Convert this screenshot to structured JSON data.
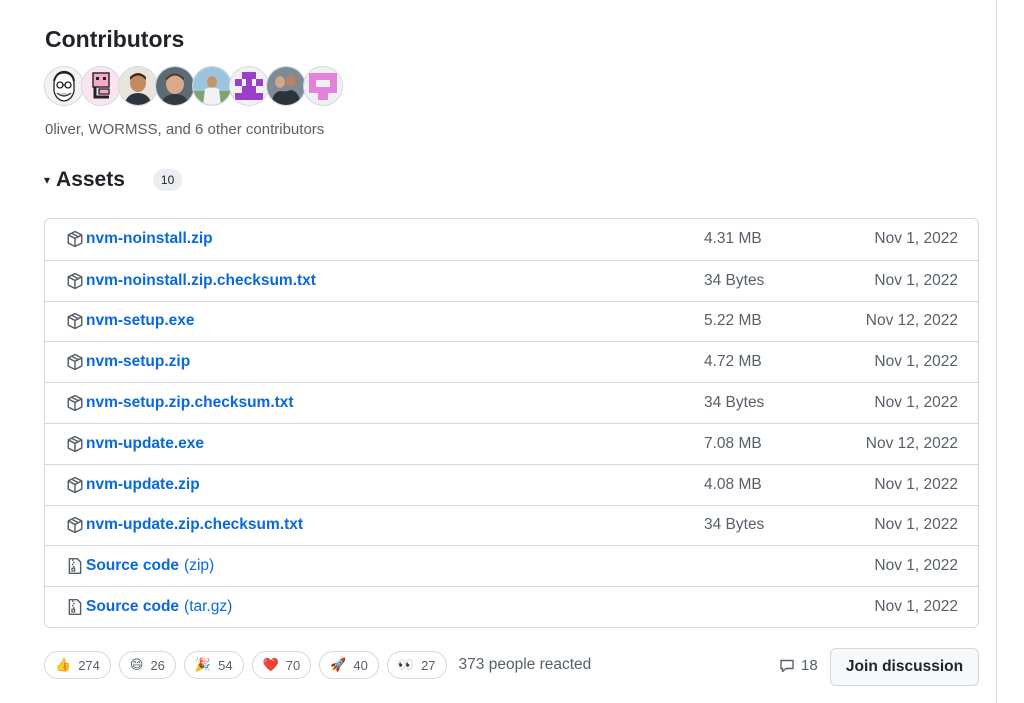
{
  "contributors": {
    "title": "Contributors",
    "summary": "0liver, WORMSS, and 6 other contributors",
    "avatars": [
      "avatar-sketch",
      "avatar-pink-pixel",
      "avatar-photo",
      "avatar-photo",
      "avatar-photo",
      "avatar-purple-identicon",
      "avatar-photo",
      "avatar-pink-identicon"
    ]
  },
  "assets": {
    "caret": "▾",
    "title": "Assets",
    "count": "10",
    "items": [
      {
        "name": "nvm-noinstall.zip",
        "suffix": "",
        "size": "4.31 MB",
        "date": "Nov 1, 2022",
        "icon": "package-icon"
      },
      {
        "name": "nvm-noinstall.zip.checksum.txt",
        "suffix": "",
        "size": "34 Bytes",
        "date": "Nov 1, 2022",
        "icon": "package-icon"
      },
      {
        "name": "nvm-setup.exe",
        "suffix": "",
        "size": "5.22 MB",
        "date": "Nov 12, 2022",
        "icon": "package-icon"
      },
      {
        "name": "nvm-setup.zip",
        "suffix": "",
        "size": "4.72 MB",
        "date": "Nov 1, 2022",
        "icon": "package-icon"
      },
      {
        "name": "nvm-setup.zip.checksum.txt",
        "suffix": "",
        "size": "34 Bytes",
        "date": "Nov 1, 2022",
        "icon": "package-icon"
      },
      {
        "name": "nvm-update.exe",
        "suffix": "",
        "size": "7.08 MB",
        "date": "Nov 12, 2022",
        "icon": "package-icon"
      },
      {
        "name": "nvm-update.zip",
        "suffix": "",
        "size": "4.08 MB",
        "date": "Nov 1, 2022",
        "icon": "package-icon"
      },
      {
        "name": "nvm-update.zip.checksum.txt",
        "suffix": "",
        "size": "34 Bytes",
        "date": "Nov 1, 2022",
        "icon": "package-icon"
      },
      {
        "name": "Source code",
        "suffix": "(zip)",
        "size": "",
        "date": "Nov 1, 2022",
        "icon": "file-zip-icon"
      },
      {
        "name": "Source code",
        "suffix": "(tar.gz)",
        "size": "",
        "date": "Nov 1, 2022",
        "icon": "file-zip-icon"
      }
    ]
  },
  "reactions": {
    "items": [
      {
        "emoji": "👍",
        "count": "274",
        "icon": "thumbs-up-icon"
      },
      {
        "emoji": "😄",
        "count": "26",
        "icon": "smile-icon"
      },
      {
        "emoji": "🎉",
        "count": "54",
        "icon": "party-icon"
      },
      {
        "emoji": "❤️",
        "count": "70",
        "icon": "heart-icon"
      },
      {
        "emoji": "🚀",
        "count": "40",
        "icon": "rocket-icon"
      },
      {
        "emoji": "👀",
        "count": "27",
        "icon": "eyes-icon"
      }
    ],
    "summary": "373 people reacted"
  },
  "discussion": {
    "comments": "18",
    "join_label": "Join discussion"
  },
  "colors": {
    "link": "#0969da",
    "muted": "#57606a",
    "border": "#d0d7de"
  }
}
